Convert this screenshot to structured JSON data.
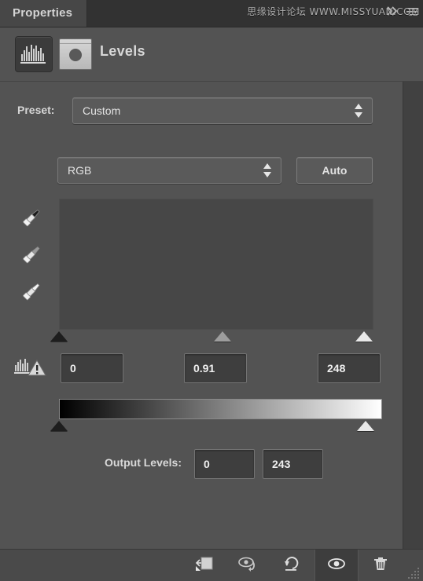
{
  "window": {
    "tab_label": "Properties",
    "watermark": "思缘设计论坛 WWW.MISSYUAN.COM",
    "collapse_icon": "double-chevron-right-icon",
    "menu_icon": "panel-menu-icon"
  },
  "title": {
    "adjustment_icon": "levels-histogram-icon",
    "mask_thumbnail_icon": "layer-mask-thumbnail-icon",
    "text": "Levels"
  },
  "preset": {
    "label": "Preset:",
    "value": "Custom",
    "stepper_icon": "stepper-up-down-icon"
  },
  "channel": {
    "value": "RGB",
    "stepper_icon": "stepper-up-down-icon",
    "auto_label": "Auto"
  },
  "eyedroppers": [
    {
      "name": "set-black-point-eyedropper"
    },
    {
      "name": "set-gray-point-eyedropper"
    },
    {
      "name": "set-white-point-eyedropper"
    }
  ],
  "histogram": {
    "warning_icon": "histogram-cached-data-warning-icon",
    "empty": true
  },
  "input_levels": {
    "black": "0",
    "gamma": "0.91",
    "white": "248",
    "black_slider_pct": 0,
    "gray_slider_pct": 52,
    "white_slider_pct": 97
  },
  "output_levels": {
    "label": "Output Levels:",
    "black": "0",
    "white": "243",
    "black_slider_pct": 0,
    "white_slider_pct": 95
  },
  "toolbar": {
    "buttons": [
      {
        "name": "clip-to-layer-button",
        "icon": "clip-to-layer-icon",
        "active": false
      },
      {
        "name": "view-previous-state-button",
        "icon": "eye-previous-state-icon",
        "active": false
      },
      {
        "name": "reset-adjustment-button",
        "icon": "reset-arrow-icon",
        "active": false
      },
      {
        "name": "toggle-layer-visibility-button",
        "icon": "eye-icon",
        "active": true
      },
      {
        "name": "delete-adjustment-button",
        "icon": "trash-icon",
        "active": false
      }
    ],
    "resize_grip_icon": "resize-grip-icon"
  },
  "colors": {
    "panel_bg": "#535353",
    "tabbar_bg": "#323232",
    "tab_active_bg": "#474747",
    "field_bg": "#3e3e3e",
    "button_bg": "#5a5a5a",
    "text": "#e3e3e3"
  }
}
